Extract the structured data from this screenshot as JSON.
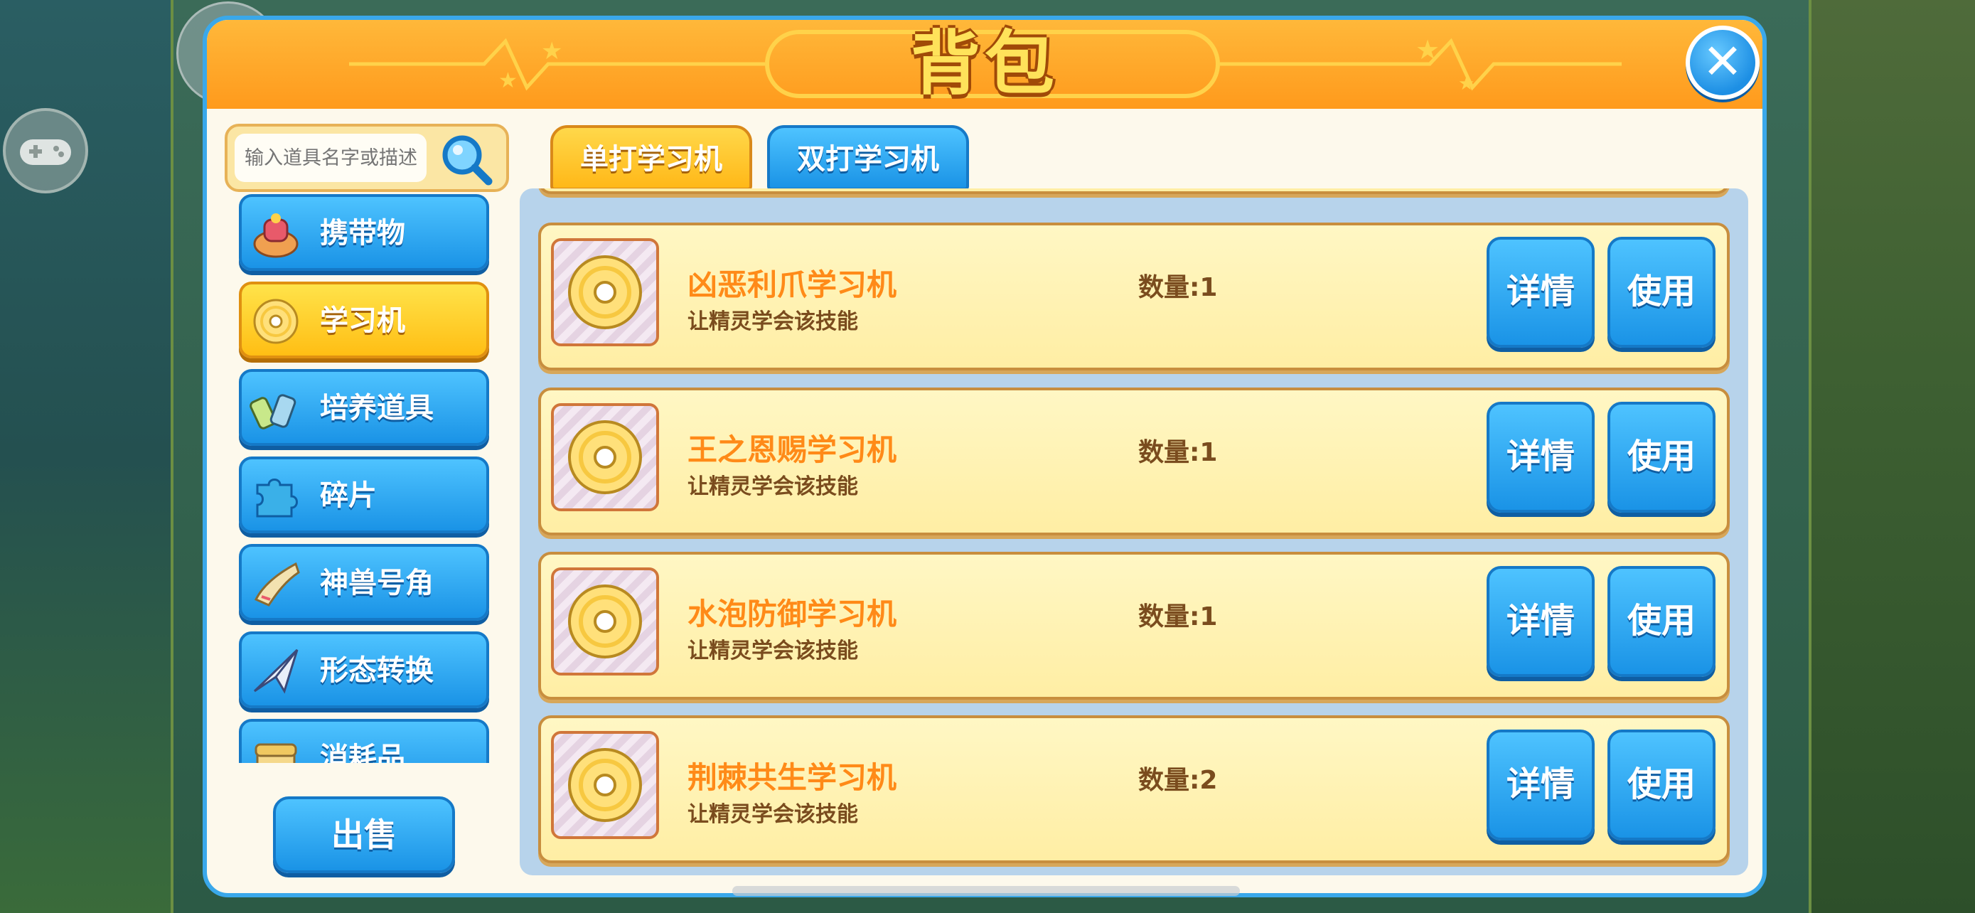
{
  "window": {
    "title": "背包"
  },
  "search": {
    "placeholder": "输入道具名字或描述"
  },
  "categories": [
    {
      "label": "携带物",
      "icon": "bag-item-icon",
      "active": false
    },
    {
      "label": "学习机",
      "icon": "disc-icon",
      "active": true
    },
    {
      "label": "培养道具",
      "icon": "potion-bottles-icon",
      "active": false
    },
    {
      "label": "碎片",
      "icon": "puzzle-piece-icon",
      "active": false
    },
    {
      "label": "神兽号角",
      "icon": "horn-icon",
      "active": false
    },
    {
      "label": "形态转换",
      "icon": "paper-plane-icon",
      "active": false
    },
    {
      "label": "消耗品",
      "icon": "treasure-box-icon",
      "active": false
    }
  ],
  "sell_label": "出售",
  "tabs": [
    {
      "label": "单打学习机",
      "active": true
    },
    {
      "label": "双打学习机",
      "active": false
    }
  ],
  "items": [
    {
      "name": "凶恶利爪学习机",
      "desc": "让精灵学会该技能",
      "qty": "数量:1",
      "detail_label": "详情",
      "use_label": "使用"
    },
    {
      "name": "王之恩赐学习机",
      "desc": "让精灵学会该技能",
      "qty": "数量:1",
      "detail_label": "详情",
      "use_label": "使用"
    },
    {
      "name": "水泡防御学习机",
      "desc": "让精灵学会该技能",
      "qty": "数量:1",
      "detail_label": "详情",
      "use_label": "使用"
    },
    {
      "name": "荆棘共生学习机",
      "desc": "让精灵学会该技能",
      "qty": "数量:2",
      "detail_label": "详情",
      "use_label": "使用"
    }
  ],
  "colors": {
    "accent_blue": "#1a93e6",
    "accent_orange": "#ff9a1c",
    "item_name": "#ff8a18",
    "active_yellow": "#ffbe14"
  }
}
